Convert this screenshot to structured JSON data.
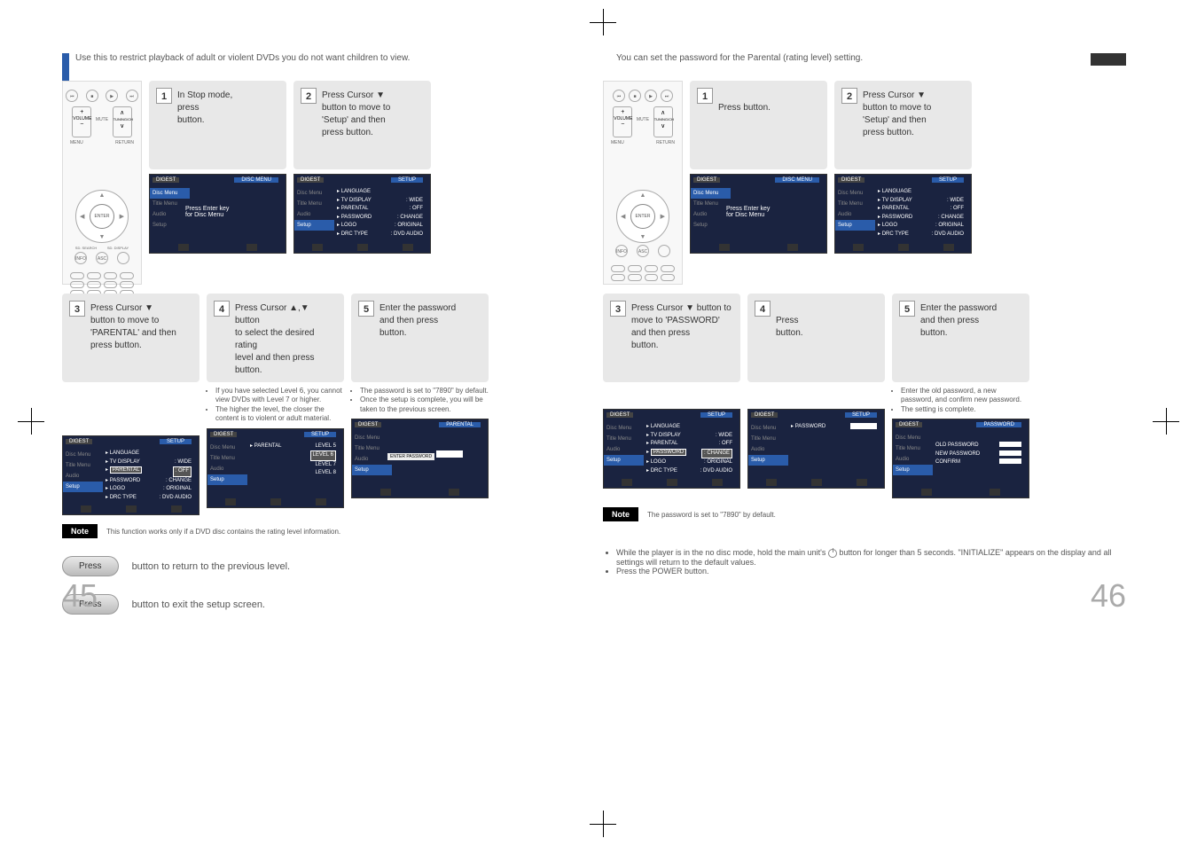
{
  "left_page": {
    "intro": "Use this to restrict playback of adult or violent DVDs you do not want children to view.",
    "step1": {
      "line1": "In Stop mode,",
      "line2": "press",
      "line3": "button."
    },
    "step2": {
      "line1": "Press Cursor ▼",
      "line2": "button to move to",
      "line3": "'Setup' and then",
      "line4": "press",
      "line5": "button."
    },
    "step3": {
      "line1": "Press Cursor ▼",
      "line2": "button to move to",
      "line3": "'PARENTAL' and then",
      "line4": "press",
      "line5": "button."
    },
    "step4": {
      "line1": "Press Cursor ▲,▼ button",
      "line2": "to select the desired rating",
      "line3": "level and then press",
      "line4": "button."
    },
    "step4_bullets": {
      "b1": "If you have selected Level 6, you cannot view DVDs with Level 7 or higher.",
      "b2": "The higher the level, the closer the content is to violent or adult material."
    },
    "step5": {
      "line1": "Enter the password",
      "line2": "and then press",
      "line3": "button."
    },
    "step5_bullets": {
      "b1": "The password is set to \"7890\" by default.",
      "b2": "Once the setup is complete, you will be taken to the previous screen."
    },
    "note": "This function works only if a DVD disc contains the rating level information.",
    "footer_return": "button to return to the previous level.",
    "footer_exit": "button to exit the setup screen.",
    "press": "Press",
    "page_num": "45",
    "screenshots": {
      "disc_menu": {
        "title": "DISC MENU",
        "text1": "Press Enter key",
        "text2": "for Disc Menu"
      },
      "setup": {
        "title": "SETUP",
        "items": [
          {
            "l": "LANGUAGE",
            "r": ""
          },
          {
            "l": "TV DISPLAY",
            "r": ": WIDE"
          },
          {
            "l": "PARENTAL",
            "r": ": OFF"
          },
          {
            "l": "PASSWORD",
            "r": ": CHANGE"
          },
          {
            "l": "LOGO",
            "r": ": ORIGINAL"
          },
          {
            "l": "DRC TYPE",
            "r": ": DVD AUDIO"
          }
        ]
      },
      "parental_levels": {
        "title": "SETUP",
        "label": "PARENTAL",
        "levels": [
          "LEVEL 5",
          "LEVEL 6",
          "LEVEL 7",
          "LEVEL 8"
        ],
        "highlight": "LEVEL 6"
      },
      "password_entry": {
        "title": "PARENTAL",
        "label": "ENTER PASSWORD"
      },
      "sidebar_tabs": [
        "Disc Menu",
        "Title Menu",
        "Audio",
        "Setup"
      ]
    }
  },
  "right_page": {
    "intro": "You can set the password for the Parental (rating level) setting.",
    "step1": {
      "line1": "Press",
      "line2": "button."
    },
    "step2": {
      "line1": "Press Cursor ▼",
      "line2": "button to move to",
      "line3": "'Setup' and then",
      "line4": "press",
      "line5": "button."
    },
    "step3": {
      "line1": "Press Cursor ▼ button to",
      "line2": "move to 'PASSWORD'",
      "line3": "and then press",
      "line4": "button."
    },
    "step4": {
      "line1": "Press",
      "line2": "button."
    },
    "step5": {
      "line1": "Enter the password",
      "line2": "and then press",
      "line3": "button."
    },
    "step5_bullets": {
      "b1": "Enter the old password, a new password, and confirm new password.",
      "b2": "The setting is complete."
    },
    "note": "The password is set to \"7890\" by default.",
    "initialize": {
      "b1_pre": "While the player is in the no disc mode, hold the main unit's",
      "b1_post": "button for longer than 5 seconds. \"INITIALIZE\" appears on the display and all settings will return to the default values.",
      "b2": "Press the POWER button."
    },
    "page_num": "46",
    "screenshots": {
      "password_screen": {
        "title": "SETUP",
        "label": "PASSWORD"
      },
      "password_change": {
        "title": "PASSWORD",
        "fields": [
          "OLD PASSWORD",
          "NEW PASSWORD",
          "CONFIRM"
        ]
      }
    }
  },
  "remote": {
    "enter": "ENTER",
    "mute": "MUTE",
    "volume": "VOLUME",
    "tuning": "TUNING/CH",
    "menu": "MENU",
    "return": "RETURN",
    "info": "INFO",
    "asc": "ASC",
    "sd_search": "SD. SEARCH",
    "sd_display": "SD. DISPLAY"
  },
  "note_label": "Note"
}
